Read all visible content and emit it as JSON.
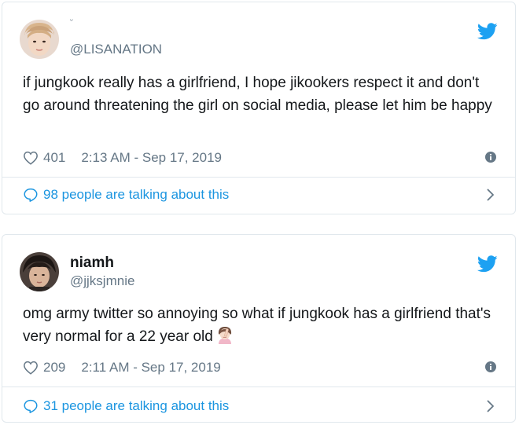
{
  "tweets": [
    {
      "display_name": "",
      "handle": "@LISANATION",
      "text": "if jungkook really has a girlfriend, I hope jikookers respect it and don't go around threatening the girl on social media, please let him be happy",
      "likes": "401",
      "timestamp": "2:13 AM - Sep 17, 2019",
      "talking": "98 people are talking about this",
      "avatar_icon": "user-avatar"
    },
    {
      "display_name": "niamh",
      "handle": "@jjksjmnie",
      "text": "omg army twitter so annoying so what if jungkook has a girlfriend that's very normal for a 22 year old",
      "likes": "209",
      "timestamp": "2:11 AM - Sep 17, 2019",
      "talking": "31 people are talking about this",
      "avatar_icon": "user-avatar",
      "emoji": "woman-facepalming-emoji"
    }
  ],
  "colors": {
    "twitter_blue": "#1da1f2",
    "link_blue": "#1b95e0",
    "muted": "#657786",
    "border": "#e1e8ed"
  }
}
